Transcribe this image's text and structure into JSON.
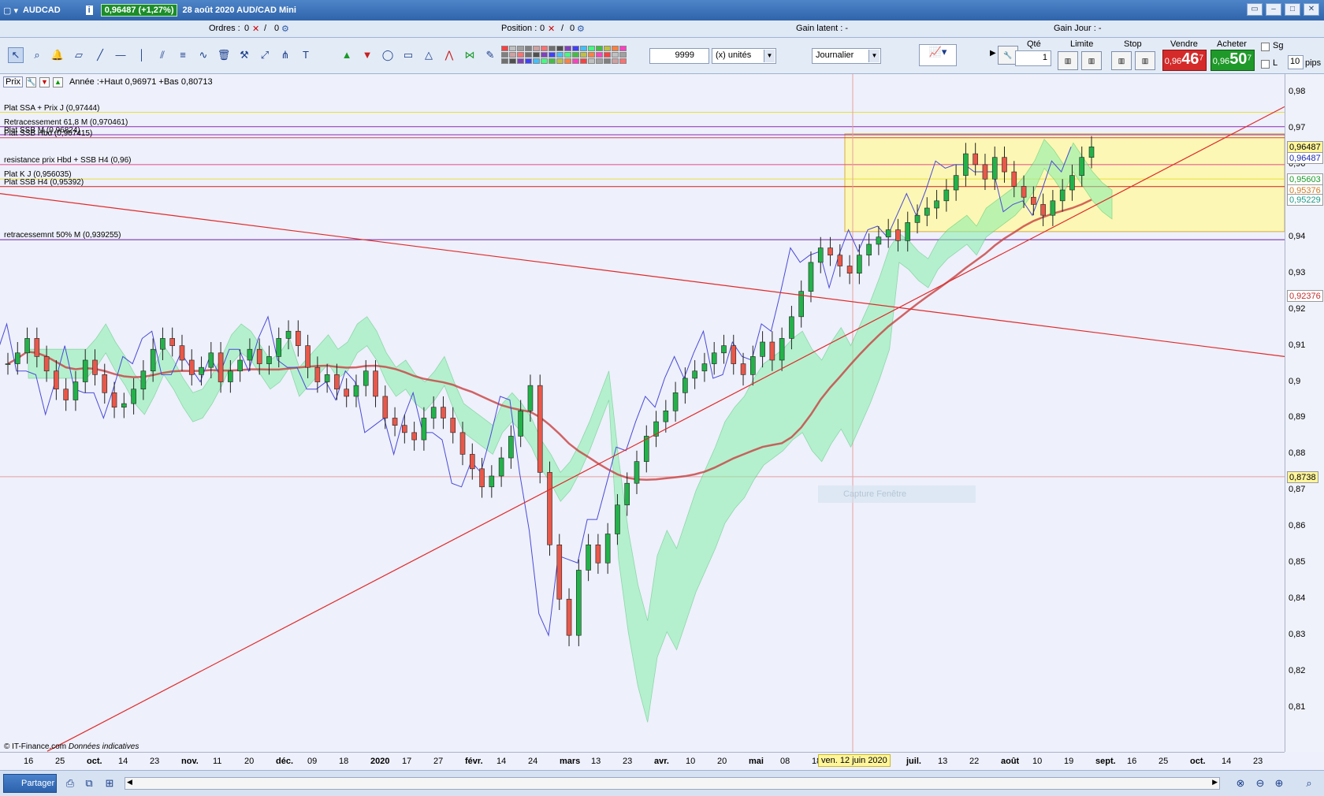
{
  "window": {
    "symbol": "AUDCAD",
    "price_badge": "0,96487 (+1,27%)",
    "date_instrument": "28 août 2020 AUD/CAD Mini"
  },
  "infobar": {
    "orders_label": "Ordres :",
    "orders_value": "0",
    "orders_total": "0",
    "position_label": "Position :",
    "position_value": "0",
    "position_total": "0",
    "gain_latent": "Gain latent : -",
    "gain_jour": "Gain Jour : -"
  },
  "toolbar": {
    "quantity": "9999",
    "units": "(x) unités",
    "period": "Journalier"
  },
  "order_panel": {
    "qty_label": "Qté",
    "qty_value": "1",
    "limit_label": "Limite",
    "stop_label": "Stop",
    "sell_label": "Vendre",
    "buy_label": "Acheter",
    "sell_small": "0,96",
    "sell_big": "46",
    "sell_sup": "7",
    "buy_small": "0,96",
    "buy_big": "50",
    "buy_sup": "7",
    "sg_label": "Sg",
    "l_label": "L",
    "pips_value": "10",
    "pips_label": "pips"
  },
  "chart_header": {
    "prix": "Prix",
    "info": "Année :+Haut 0,96971 +Bas 0,80713"
  },
  "levels": [
    {
      "label": "Plat SSA + Prix J (0,97444)",
      "color": "#e9e040"
    },
    {
      "label": "Retracessement 61,8 M (0,970461)",
      "color": "#8a2ab0"
    },
    {
      "label": "Plat SSB M (0,96824)",
      "color": "#8a2ab0"
    },
    {
      "label": "Plat SSB Hbd (0,967415)",
      "color": "#d04060"
    },
    {
      "label": "resistance prix Hbd + SSB H4 (0,96)",
      "color": "#e04a8a"
    },
    {
      "label": "Plat K J (0,956035)",
      "color": "#e9e040"
    },
    {
      "label": "Plat SSB H4 (0,95392)",
      "color": "#cc2020"
    },
    {
      "label": "retracessemnt 50% M (0,939255)",
      "color": "#6a20a0"
    }
  ],
  "chart_data": {
    "type": "candlestick",
    "instrument": "AUD/CAD",
    "timeframe": "Journalier",
    "ylim": [
      0.8,
      0.985
    ],
    "y_ticks": [
      "0,98",
      "0,97",
      "0,96",
      "0,95",
      "0,94",
      "0,93",
      "0,92",
      "0,91",
      "0,9",
      "0,89",
      "0,88",
      "0,87",
      "0,86",
      "0,85",
      "0,84",
      "0,83",
      "0,82",
      "0,81"
    ],
    "x_ticks": [
      "16",
      "25",
      "oct.",
      "14",
      "23",
      "nov.",
      "11",
      "20",
      "déc.",
      "09",
      "18",
      "2020",
      "17",
      "27",
      "févr.",
      "14",
      "24",
      "mars",
      "13",
      "23",
      "avr.",
      "10",
      "20",
      "mai",
      "08",
      "18",
      "juin",
      "24",
      "juil.",
      "13",
      "22",
      "août",
      "10",
      "19",
      "sept.",
      "16",
      "25",
      "oct.",
      "14",
      "23"
    ],
    "bold_x_ticks": [
      "oct.",
      "nov.",
      "déc.",
      "2020",
      "févr.",
      "mars",
      "avr.",
      "mai",
      "juin",
      "juil.",
      "août",
      "sept.",
      "oct."
    ],
    "price_tags": [
      {
        "value": "0,96487",
        "bg": "#fff59b",
        "fg": "#000"
      },
      {
        "value": "0,96487",
        "bg": "#ffffff",
        "fg": "#1a2ab0"
      },
      {
        "value": "0,95603",
        "bg": "#ffffff",
        "fg": "#1a9a2a"
      },
      {
        "value": "0,95376",
        "bg": "#ffffff",
        "fg": "#d07a20"
      },
      {
        "value": "0,95229",
        "bg": "#ffffff",
        "fg": "#1a9a8a"
      },
      {
        "value": "0,92376",
        "bg": "#ffffff",
        "fg": "#c03030"
      },
      {
        "value": "0,8738",
        "bg": "#fff59b",
        "fg": "#000"
      }
    ],
    "close_path": [
      0.905,
      0.908,
      0.912,
      0.907,
      0.903,
      0.898,
      0.895,
      0.9,
      0.906,
      0.902,
      0.897,
      0.893,
      0.894,
      0.898,
      0.903,
      0.909,
      0.912,
      0.91,
      0.906,
      0.902,
      0.904,
      0.908,
      0.9,
      0.903,
      0.906,
      0.909,
      0.905,
      0.907,
      0.912,
      0.914,
      0.91,
      0.904,
      0.9,
      0.902,
      0.898,
      0.896,
      0.899,
      0.903,
      0.896,
      0.89,
      0.888,
      0.886,
      0.884,
      0.89,
      0.893,
      0.89,
      0.886,
      0.88,
      0.876,
      0.871,
      0.874,
      0.879,
      0.885,
      0.892,
      0.899,
      0.875,
      0.855,
      0.84,
      0.83,
      0.848,
      0.855,
      0.85,
      0.858,
      0.866,
      0.872,
      0.878,
      0.885,
      0.889,
      0.892,
      0.897,
      0.901,
      0.903,
      0.905,
      0.908,
      0.91,
      0.905,
      0.902,
      0.907,
      0.911,
      0.906,
      0.912,
      0.918,
      0.925,
      0.933,
      0.937,
      0.935,
      0.932,
      0.93,
      0.935,
      0.938,
      0.94,
      0.942,
      0.939,
      0.944,
      0.946,
      0.948,
      0.95,
      0.953,
      0.957,
      0.963,
      0.96,
      0.956,
      0.962,
      0.958,
      0.954,
      0.951,
      0.949,
      0.946,
      0.95,
      0.953,
      0.957,
      0.962,
      0.9649
    ],
    "annotations": [
      "ven. 12 juin 2020",
      "Capture Fenêtre",
      "© IT-Finance.com",
      "Données indicatives"
    ]
  },
  "footer": {
    "share": "Partager"
  }
}
